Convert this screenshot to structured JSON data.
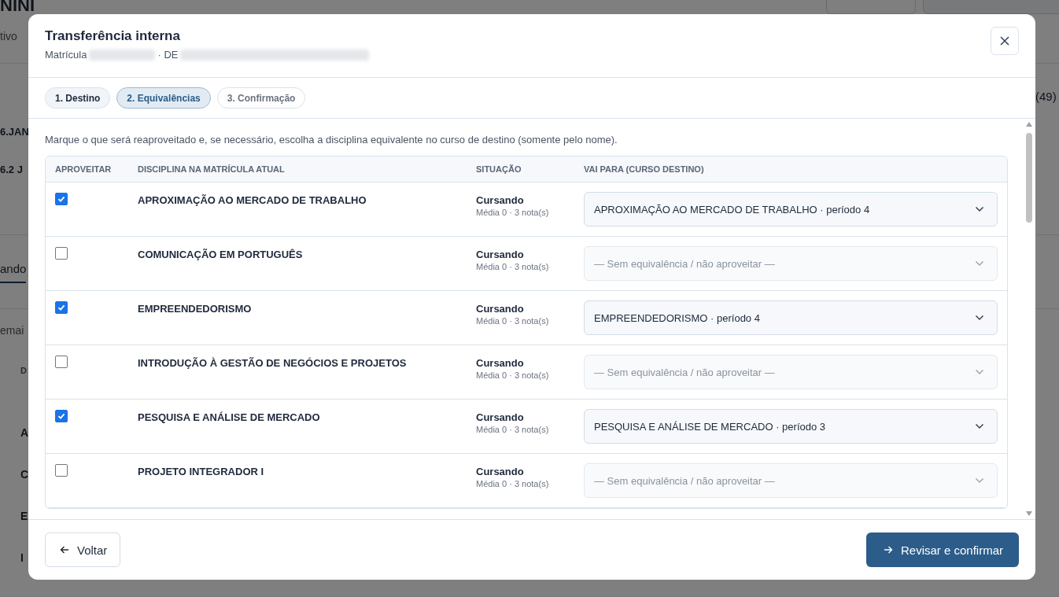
{
  "background": {
    "heading": "NINI",
    "status": "tivo",
    "count": "(49)",
    "periods": [
      "6.JAN",
      "6.2 J"
    ],
    "tab": "ando",
    "search": "emai",
    "column_header": "D",
    "rows": [
      "A",
      "C",
      "E",
      "I"
    ]
  },
  "modal": {
    "title": "Transferência interna",
    "subtitle_label": "Matrícula",
    "subtitle_separator": "· DE",
    "steps": [
      {
        "label": "1. Destino",
        "selected": false,
        "completed": true
      },
      {
        "label": "2. Equivalências",
        "selected": true,
        "completed": false
      },
      {
        "label": "3. Confirmação",
        "selected": false,
        "completed": false
      }
    ],
    "instructions": "Marque o que será reaproveitado e, se necessário, escolha a disciplina equivalente no curso de destino (somente pelo nome).",
    "table": {
      "columns": [
        "APROVEITAR",
        "DISCIPLINA NA MATRÍCULA ATUAL",
        "SITUAÇÃO",
        "VAI PARA (CURSO DESTINO)"
      ],
      "rows": [
        {
          "checked": true,
          "discipline": "APROXIMAÇÃO AO MERCADO DE TRABALHO",
          "status": "Cursando",
          "detail": "Média 0 · 3 nota(s)",
          "target": "APROXIMAÇÃO AO MERCADO DE TRABALHO · período 4",
          "target_empty": false
        },
        {
          "checked": false,
          "discipline": "COMUNICAÇÃO EM PORTUGUÊS",
          "status": "Cursando",
          "detail": "Média 0 · 3 nota(s)",
          "target": "— Sem equivalência / não aproveitar —",
          "target_empty": true
        },
        {
          "checked": true,
          "discipline": "EMPREENDEDORISMO",
          "status": "Cursando",
          "detail": "Média 0 · 3 nota(s)",
          "target": "EMPREENDEDORISMO · período 4",
          "target_empty": false
        },
        {
          "checked": false,
          "discipline": "INTRODUÇÃO À GESTÃO DE NEGÓCIOS E PROJETOS",
          "status": "Cursando",
          "detail": "Média 0 · 3 nota(s)",
          "target": "— Sem equivalência / não aproveitar —",
          "target_empty": true
        },
        {
          "checked": true,
          "discipline": "PESQUISA E ANÁLISE DE MERCADO",
          "status": "Cursando",
          "detail": "Média 0 · 3 nota(s)",
          "target": "PESQUISA E ANÁLISE DE MERCADO · período 3",
          "target_empty": false
        },
        {
          "checked": false,
          "discipline": "PROJETO INTEGRADOR I",
          "status": "Cursando",
          "detail": "Média 0 · 3 nota(s)",
          "target": "— Sem equivalência / não aproveitar —",
          "target_empty": true
        }
      ]
    },
    "back_button": "Voltar",
    "confirm_button": "Revisar e confirmar"
  }
}
